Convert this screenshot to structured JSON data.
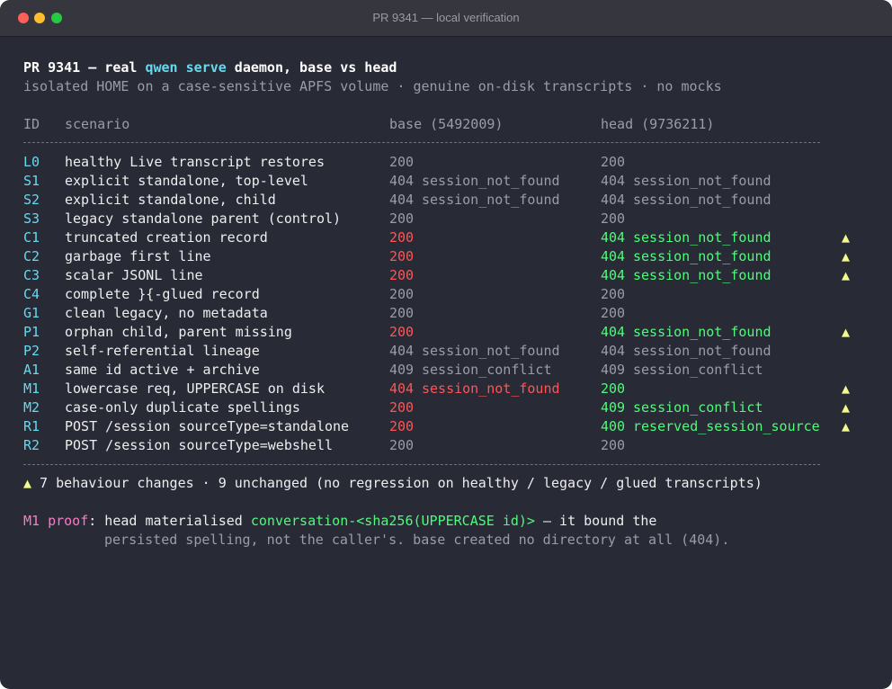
{
  "window": {
    "title": "PR 9341 — local verification"
  },
  "header": {
    "prefix": "PR 9341 — real ",
    "command": "qwen serve",
    "suffix": " daemon, base vs head",
    "subtitle": "isolated HOME on a case-sensitive APFS volume · genuine on-disk transcripts · no mocks"
  },
  "columns": {
    "id": "ID",
    "scenario": "scenario",
    "base": "base (5492009)",
    "head": "head (9736211)"
  },
  "rows": [
    {
      "id": "L0",
      "scenario": "healthy Live transcript restores",
      "base_code": "200",
      "base_msg": "",
      "head_code": "200",
      "head_msg": "",
      "marker": ""
    },
    {
      "id": "S1",
      "scenario": "explicit standalone, top-level",
      "base_code": "404",
      "base_msg": "session_not_found",
      "head_code": "404",
      "head_msg": "session_not_found",
      "marker": ""
    },
    {
      "id": "S2",
      "scenario": "explicit standalone, child",
      "base_code": "404",
      "base_msg": "session_not_found",
      "head_code": "404",
      "head_msg": "session_not_found",
      "marker": ""
    },
    {
      "id": "S3",
      "scenario": "legacy standalone parent (control)",
      "base_code": "200",
      "base_msg": "",
      "head_code": "200",
      "head_msg": "",
      "marker": ""
    },
    {
      "id": "C1",
      "scenario": "truncated creation record",
      "base_code": "200",
      "base_msg": "",
      "head_code": "404",
      "head_msg": "session_not_found",
      "marker": "▲"
    },
    {
      "id": "C2",
      "scenario": "garbage first line",
      "base_code": "200",
      "base_msg": "",
      "head_code": "404",
      "head_msg": "session_not_found",
      "marker": "▲"
    },
    {
      "id": "C3",
      "scenario": "scalar JSONL line",
      "base_code": "200",
      "base_msg": "",
      "head_code": "404",
      "head_msg": "session_not_found",
      "marker": "▲"
    },
    {
      "id": "C4",
      "scenario": "complete }{-glued record",
      "base_code": "200",
      "base_msg": "",
      "head_code": "200",
      "head_msg": "",
      "marker": ""
    },
    {
      "id": "G1",
      "scenario": "clean legacy, no metadata",
      "base_code": "200",
      "base_msg": "",
      "head_code": "200",
      "head_msg": "",
      "marker": ""
    },
    {
      "id": "P1",
      "scenario": "orphan child, parent missing",
      "base_code": "200",
      "base_msg": "",
      "head_code": "404",
      "head_msg": "session_not_found",
      "marker": "▲"
    },
    {
      "id": "P2",
      "scenario": "self-referential lineage",
      "base_code": "404",
      "base_msg": "session_not_found",
      "head_code": "404",
      "head_msg": "session_not_found",
      "marker": ""
    },
    {
      "id": "A1",
      "scenario": "same id active + archive",
      "base_code": "409",
      "base_msg": "session_conflict",
      "head_code": "409",
      "head_msg": "session_conflict",
      "marker": ""
    },
    {
      "id": "M1",
      "scenario": "lowercase req, UPPERCASE on disk",
      "base_code": "404",
      "base_msg": "session_not_found",
      "head_code": "200",
      "head_msg": "",
      "marker": "▲"
    },
    {
      "id": "M2",
      "scenario": "case-only duplicate spellings",
      "base_code": "200",
      "base_msg": "",
      "head_code": "409",
      "head_msg": "session_conflict",
      "marker": "▲"
    },
    {
      "id": "R1",
      "scenario": "POST /session sourceType=standalone",
      "base_code": "200",
      "base_msg": "",
      "head_code": "400",
      "head_msg": "reserved_session_source",
      "marker": "▲"
    },
    {
      "id": "R2",
      "scenario": "POST /session sourceType=webshell",
      "base_code": "200",
      "base_msg": "",
      "head_code": "200",
      "head_msg": "",
      "marker": ""
    }
  ],
  "summary": {
    "marker": "▲",
    "text": " 7 behaviour changes · 9 unchanged (no regression on healthy / legacy / glued transcripts)"
  },
  "proof": {
    "label": "M1 proof",
    "colon": ":",
    "pre": " head materialised ",
    "path": "conversation-<sha256(UPPERCASE id)>",
    "post": " — it bound the",
    "line2": "persisted spelling, not the caller's. base created no directory at all (404)."
  },
  "colors": {
    "background": "#282a36",
    "changed": "#ff5555",
    "fixed": "#50fa7b",
    "marker": "#f1fa8c",
    "id": "#66d9ef",
    "proof_label": "#ff79c6"
  }
}
